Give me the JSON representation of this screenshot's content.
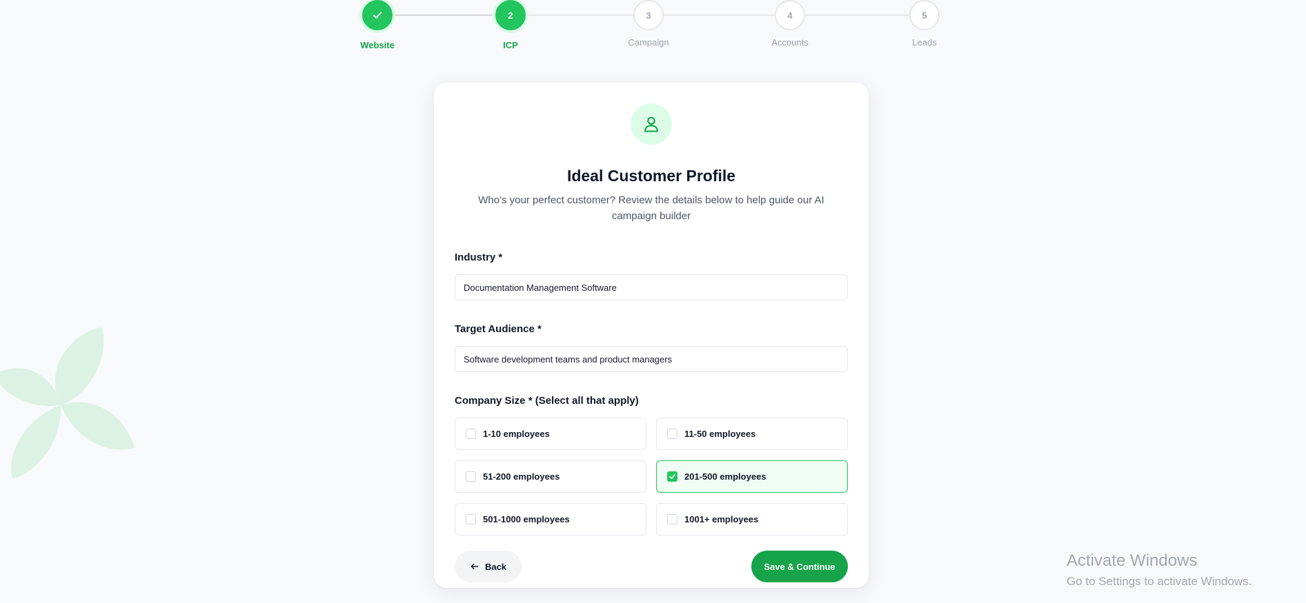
{
  "stepper": {
    "steps": [
      {
        "number": "",
        "label": "Website",
        "status": "complete"
      },
      {
        "number": "2",
        "label": "ICP",
        "status": "active"
      },
      {
        "number": "3",
        "label": "Campaign",
        "status": "pending"
      },
      {
        "number": "4",
        "label": "Accounts",
        "status": "pending"
      },
      {
        "number": "5",
        "label": "Leads",
        "status": "pending"
      }
    ],
    "complete_icon": "check-icon"
  },
  "card": {
    "icon": "user-icon",
    "title": "Ideal Customer Profile",
    "subtitle": "Who's your perfect customer? Review the details below to help guide our AI campaign builder"
  },
  "form": {
    "industry": {
      "label": "Industry *",
      "value": "Documentation Management Software"
    },
    "target_audience": {
      "label": "Target Audience *",
      "value": "Software development teams and product managers"
    },
    "company_size": {
      "label": "Company Size * (Select all that apply)",
      "options": [
        {
          "label": "1-10 employees",
          "checked": false
        },
        {
          "label": "11-50 employees",
          "checked": false
        },
        {
          "label": "51-200 employees",
          "checked": false
        },
        {
          "label": "201-500 employees",
          "checked": true
        },
        {
          "label": "501-1000 employees",
          "checked": false
        },
        {
          "label": "1001+ employees",
          "checked": false
        }
      ]
    }
  },
  "actions": {
    "back_label": "Back",
    "back_icon": "arrow-left-icon",
    "continue_label": "Save & Continue"
  },
  "watermark": {
    "title": "Activate Windows",
    "subtitle": "Go to Settings to activate Windows."
  },
  "colors": {
    "primary": "#16a34a",
    "primary_bright": "#22c55e",
    "primary_light": "#dcfce7",
    "background": "#f8f9fb"
  }
}
